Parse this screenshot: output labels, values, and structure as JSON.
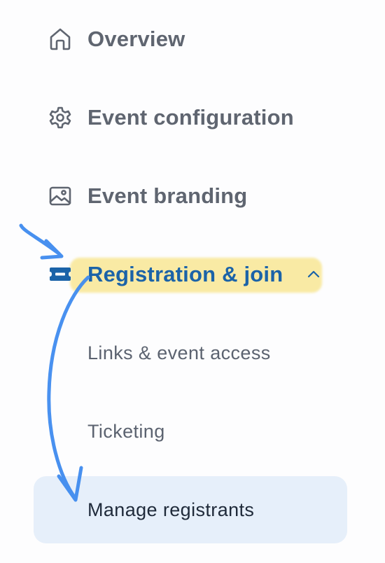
{
  "nav": {
    "items": [
      {
        "label": "Overview",
        "icon": "home-icon"
      },
      {
        "label": "Event configuration",
        "icon": "gear-icon"
      },
      {
        "label": "Event branding",
        "icon": "image-icon"
      },
      {
        "label": "Registration & join",
        "icon": "ticket-icon",
        "expanded": true
      }
    ],
    "sub_items": [
      {
        "label": "Links & event access"
      },
      {
        "label": "Ticketing"
      },
      {
        "label": "Manage registrants",
        "selected": true
      }
    ]
  },
  "colors": {
    "active_text": "#1b63a8",
    "inactive_text": "#5f6570",
    "selected_bg": "#e6effa",
    "highlighter": "#f6da5a",
    "annotation_ink": "#3f8bef"
  }
}
